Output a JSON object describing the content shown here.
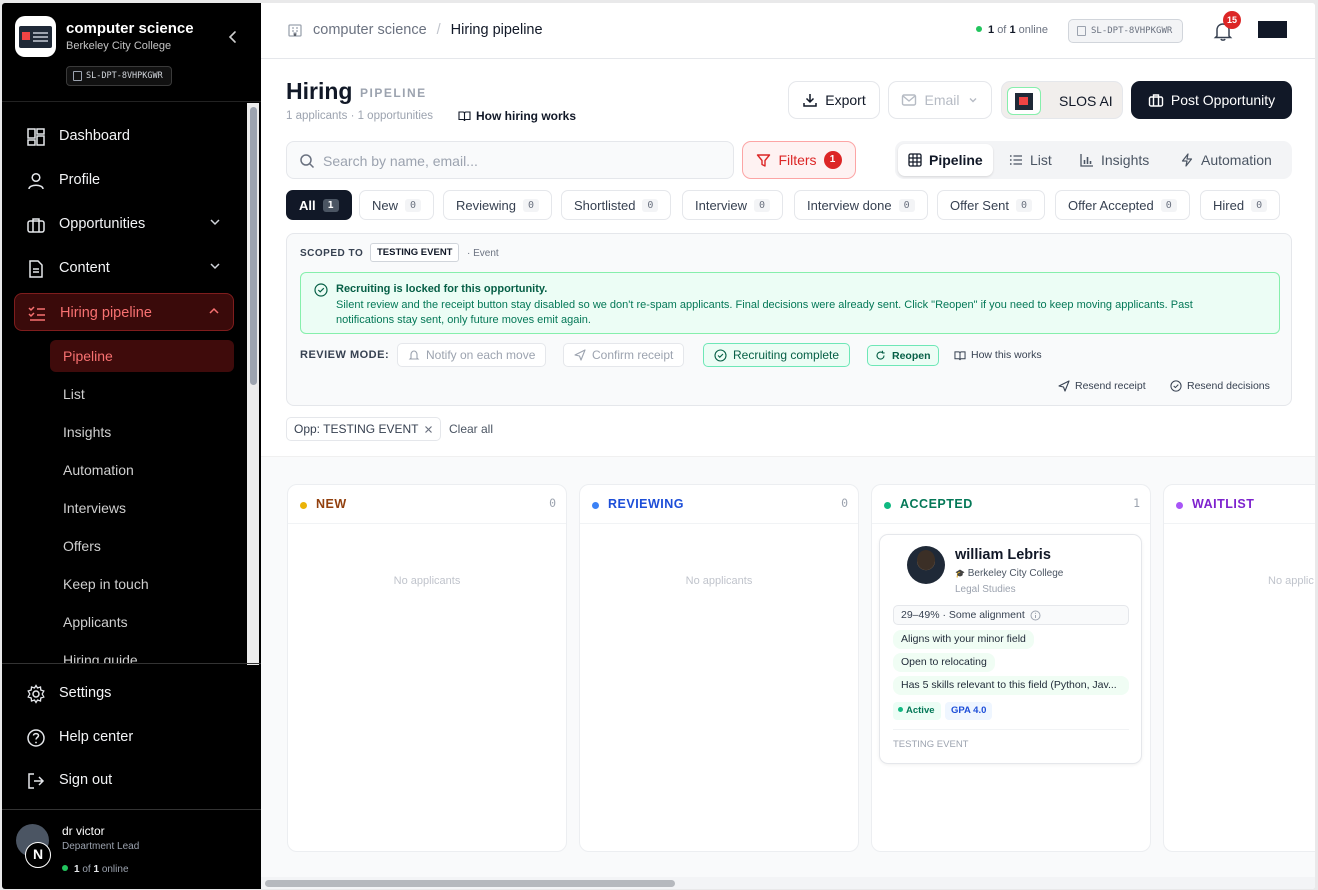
{
  "sidebar": {
    "org_name": "computer science",
    "org_sub": "Berkeley City College",
    "org_code": "SL-DPT-8VHPKGWR",
    "nav": [
      {
        "label": "Dashboard",
        "icon": "dashboard-icon"
      },
      {
        "label": "Profile",
        "icon": "user-icon"
      },
      {
        "label": "Opportunities",
        "icon": "briefcase-icon"
      },
      {
        "label": "Content",
        "icon": "document-icon"
      },
      {
        "label": "Hiring pipeline",
        "icon": "checklist-icon"
      }
    ],
    "sub": [
      "Pipeline",
      "List",
      "Insights",
      "Automation",
      "Interviews",
      "Offers",
      "Keep in touch",
      "Applicants",
      "Hiring guide"
    ],
    "bottom": [
      {
        "label": "Settings",
        "icon": "gear-icon"
      },
      {
        "label": "Help center",
        "icon": "help-icon"
      },
      {
        "label": "Sign out",
        "icon": "sign-out-icon"
      }
    ],
    "user": {
      "name": "dr victor",
      "role": "Department Lead",
      "online_a": "1",
      "online_of": "of",
      "online_b": "1",
      "online_word": "online",
      "avatar_letter": "N"
    }
  },
  "topbar": {
    "crumb_org": "computer science",
    "crumb_sep": "/",
    "crumb_page": "Hiring pipeline",
    "online_count": "1",
    "online_of": "of",
    "online_total": "1",
    "online_word": "online",
    "code": "SL-DPT-8VHPKGWR",
    "notifications": "15"
  },
  "header": {
    "title": "Hiring",
    "tag": "PIPELINE",
    "meta": "1 applicants · 1 opportunities",
    "how_link": "How hiring works",
    "export": "Export",
    "email": "Email",
    "slos": "SLOS AI",
    "post": "Post Opportunity"
  },
  "toolbar": {
    "search_placeholder": "Search by name, email...",
    "filters": "Filters",
    "filters_count": "1",
    "views": [
      "Pipeline",
      "List",
      "Insights",
      "Automation"
    ]
  },
  "stage_tabs": [
    {
      "label": "All",
      "count": "1"
    },
    {
      "label": "New",
      "count": "0"
    },
    {
      "label": "Reviewing",
      "count": "0"
    },
    {
      "label": "Shortlisted",
      "count": "0"
    },
    {
      "label": "Interview",
      "count": "0"
    },
    {
      "label": "Interview done",
      "count": "0"
    },
    {
      "label": "Offer Sent",
      "count": "0"
    },
    {
      "label": "Offer Accepted",
      "count": "0"
    },
    {
      "label": "Hired",
      "count": "0"
    }
  ],
  "scope": {
    "label": "SCOPED TO",
    "chip": "TESTING EVENT",
    "type": "· Event",
    "lock_title": "Recruiting is locked for this opportunity.",
    "lock_body": "Silent review and the receipt button stay disabled so we don't re-spam applicants. Final decisions were already sent. Click \"Reopen\" if you need to keep moving applicants. Past notifications stay sent, only future moves emit again.",
    "review_label": "REVIEW MODE:",
    "notify": "Notify on each move",
    "confirm": "Confirm receipt",
    "complete": "Recruiting complete",
    "reopen": "Reopen",
    "how": "How this works",
    "resend_receipt": "Resend receipt",
    "resend_decisions": "Resend decisions"
  },
  "active_filters": {
    "chip": "Opp: TESTING EVENT",
    "clear": "Clear all"
  },
  "columns": [
    {
      "title": "NEW",
      "count": "0",
      "color": "#eab308",
      "title_color": "#92400e",
      "empty": "No applicants"
    },
    {
      "title": "REVIEWING",
      "count": "0",
      "color": "#3b82f6",
      "title_color": "#1d4ed8",
      "empty": "No applicants"
    },
    {
      "title": "ACCEPTED",
      "count": "1",
      "color": "#10b981",
      "title_color": "#047857"
    },
    {
      "title": "WAITLIST",
      "color": "#a855f7",
      "title_color": "#7e22ce",
      "empty": "No applic"
    }
  ],
  "card": {
    "name": "william Lebris",
    "school": "Berkeley City College",
    "major": "Legal Studies",
    "score": "29–49% · Some alignment",
    "tags": [
      "Aligns with your minor field",
      "Open to relocating",
      "Has 5 skills relevant to this field (Python, Jav..."
    ],
    "status": "Active",
    "gpa": "GPA 4.0",
    "event": "TESTING EVENT"
  }
}
